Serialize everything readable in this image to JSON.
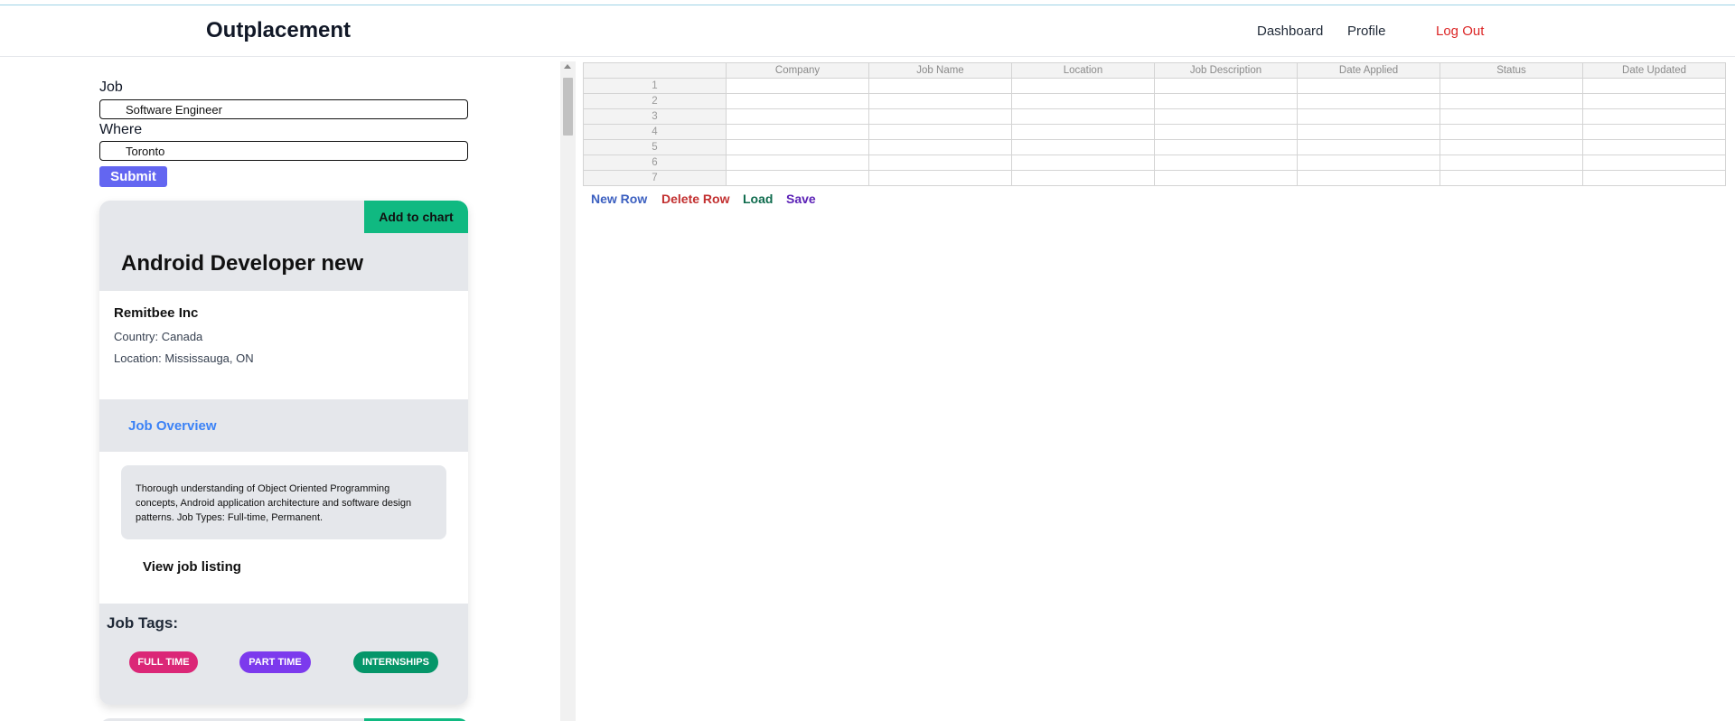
{
  "nav": {
    "brand": "Outplacement",
    "dashboard": "Dashboard",
    "profile": "Profile",
    "logout": "Log Out"
  },
  "search": {
    "job_label": "Job",
    "job_value": "Software Engineer",
    "where_label": "Where",
    "where_value": "Toronto",
    "submit_label": "Submit"
  },
  "card": {
    "add_label": "Add to chart",
    "title": "Android Developer new",
    "company": "Remitbee Inc",
    "country": "Country: Canada",
    "location": "Location: Mississauga, ON",
    "overview_label": "Job Overview",
    "description": "Thorough understanding of Object Oriented Programming concepts, Android application architecture and software design patterns. Job Types: Full-time, Permanent.",
    "view_label": "View job listing",
    "tags_title": "Job Tags:",
    "tags": [
      "FULL TIME",
      "PART TIME",
      "INTERNSHIPS"
    ]
  },
  "sheet": {
    "columns": [
      "",
      "Company",
      "Job Name",
      "Location",
      "Job Description",
      "Date Applied",
      "Status",
      "Date Updated"
    ],
    "row_numbers": [
      "1",
      "2",
      "3",
      "4",
      "5",
      "6",
      "7"
    ]
  },
  "actions": {
    "new_row": "New Row",
    "delete_row": "Delete Row",
    "load": "Load",
    "save": "Save"
  },
  "colors": {
    "accent": "#6366f1",
    "add_button": "#10b981",
    "logout": "#dc2626",
    "tag_full": "#db2777",
    "tag_part": "#7c3aed",
    "tag_intern": "#059669"
  }
}
